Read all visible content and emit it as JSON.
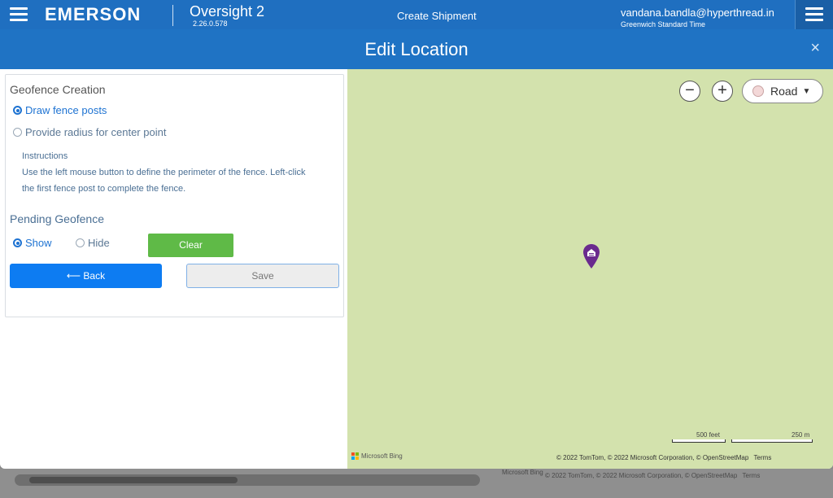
{
  "topbar": {
    "logo": "EMERSON",
    "product": "Oversight 2",
    "version": "2.26.0.578",
    "page": "Create Shipment",
    "user": "vandana.bandla@hyperthread.in",
    "timezone": "Greenwich Standard Time",
    "menu_icon": "hamburger-menu-icon"
  },
  "modal": {
    "title": "Edit Location",
    "close": "×"
  },
  "geofence": {
    "section_title": "Geofence Creation",
    "options": [
      {
        "label": "Draw fence posts",
        "selected": true
      },
      {
        "label": "Provide radius for center point",
        "selected": false
      }
    ],
    "instructions_title": "Instructions",
    "instructions_line1": "Use the left mouse button to define the perimeter of the fence. Left-click",
    "instructions_line2": "the first fence post to complete the fence."
  },
  "pending": {
    "section_title": "Pending Geofence",
    "show_label": "Show",
    "hide_label": "Hide",
    "show_selected": true,
    "clear_label": "Clear"
  },
  "actions": {
    "back_label": "Back",
    "back_icon": "⟵",
    "save_label": "Save"
  },
  "map": {
    "zoom_out": "−",
    "zoom_in": "+",
    "style_label": "Road",
    "scale_feet": "500 feet",
    "scale_m": "250 m",
    "bing": "Microsoft Bing",
    "copyright": "© 2022 TomTom, © 2022 Microsoft Corporation, © OpenStreetMap",
    "terms": "Terms",
    "pin_color": "#6a2a8e",
    "land_color": "#d3e2ad"
  },
  "background": {
    "bing": "Microsoft Bing",
    "copyright": "© 2022 TomTom, © 2022 Microsoft Corporation, © OpenStreetMap",
    "terms": "Terms"
  }
}
